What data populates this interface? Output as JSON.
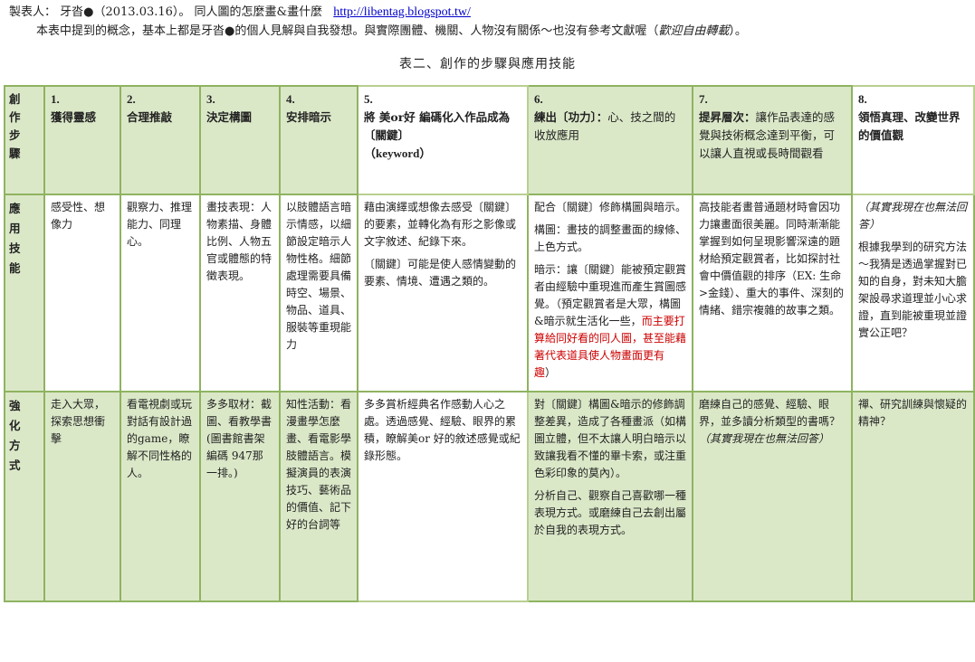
{
  "header": {
    "author_line": "製表人： 牙沓●（2013.03.16）。  同人圖的怎麼畫&畫什麼",
    "link_text": "http://libentag.blogspot.tw/",
    "notice": "本表中提到的概念，基本上都是牙沓●的個人見解與自我發想。與實際團體、機關、人物沒有關係～也沒有參考文獻喔（",
    "notice_italic": "歡迎自由轉載",
    "notice_end": "）。"
  },
  "table_title": "表二、創作的步驟與應用技能",
  "row_labels": {
    "steps": "創作步驟",
    "skills": "應用技能",
    "strengthen": "強化方式"
  },
  "steps": [
    {
      "num": "1.",
      "text": "獲得靈感"
    },
    {
      "num": "2.",
      "text": "合理推敲"
    },
    {
      "num": "3.",
      "text": "決定構圖"
    },
    {
      "num": "4.",
      "text": "安排暗示"
    },
    {
      "num": "5.",
      "text": "將 美or好 編碼化入作品成為〔關鍵〕",
      "text2": "（keyword）"
    },
    {
      "num": "6.",
      "text": "練出〔功力〕：",
      "text2": "心、技之間的收放應用"
    },
    {
      "num": "7.",
      "text": "提昇層次：",
      "text2": "讓作品表達的感覺與技術概念達到平衡，可以讓人直視或長時間觀看"
    },
    {
      "num": "8.",
      "text": "領悟真理、改變世界的價值觀"
    }
  ],
  "skills": {
    "c1": "感受性、想像力",
    "c2": "觀察力、推理能力、同理心。",
    "c3": "畫技表現：人物素描、身體比例、人物五官或體態的特徵表現。",
    "c4": "以肢體語言暗示情感，以細節設定暗示人物性格。細節處理需要具備時空、場景、物品、道具、服裝等重現能力",
    "c5a": "藉由演繹或想像去感受〔關鍵〕的要素，並轉化為有形之影像或文字敘述、紀錄下來。",
    "c5b": "〔關鍵〕可能是使人感情變動的要素、情境、遭遇之類的。",
    "c6a": "配合〔關鍵〕修飾構圖與暗示。",
    "c6b": "構圖：畫技的調整畫面的線條、上色方式。",
    "c6c": "暗示：讓〔關鍵〕能被預定觀賞者由經驗中重現進而產生賞圖感覺。（預定觀賞者是大眾，構圖&暗示就生活化一些，",
    "c6c_red": "而主要打算給同好看的同人圖，甚至能藉著代表道具使人物畫面更有趣",
    "c6c_end": "）",
    "c7": "高技能者畫普通題材時會因功力讓畫面很美麗。同時漸漸能掌握到如何呈現影響深遠的題材給預定觀賞者，比如探討社會中價值觀的排序（EX: 生命>金錢）、重大的事件、深刻的情緒、錯宗複雜的故事之類。",
    "c8a": "（其實我現在也無法回答）",
    "c8b": "根據我學到的研究方法～我猜是透過掌握對已知的自身，對未知大膽架設尋求道理並小心求證，直到能被重現並證實公正吧？"
  },
  "strengthen": {
    "c1": "走入大眾，探索思想衝擊",
    "c2": "看電視劇或玩對話有設計過的game，瞭解不同性格的人。",
    "c3": "多多取材：截圖、看教學書(圖書館書架編碼 947那一排。)",
    "c4": "知性活動：看漫畫學怎麼畫、看電影學肢體語言。模擬演員的表演技巧、藝術品的價值、記下好的台詞等",
    "c5": "多多賞析經典名作感動人心之處。透過感覺、經驗、眼界的累積，瞭解美or 好的敘述感覺或紀錄形態。",
    "c6a": "對〔關鍵〕構圖&暗示的修飾調整差異，造成了各種畫派（如構圖立體，但不太讓人明白暗示以致讓我看不懂的畢卡索，或注重色彩印象的莫內）。",
    "c6b": "分析自己、觀察自己喜歡哪一種表現方式。或磨練自己去創出屬於自我的表現方式。",
    "c7": "磨練自己的感覺、經驗、眼界，並多讀分析類型的書嗎？",
    "c7_it": "（其實我現在也無法回答）",
    "c8": "禪、研究訓練與懷疑的精神？"
  },
  "colors": {
    "border": "#8fb360",
    "shade": "#dbe8c8",
    "link": "#0000cc",
    "red": "#cc0000"
  }
}
